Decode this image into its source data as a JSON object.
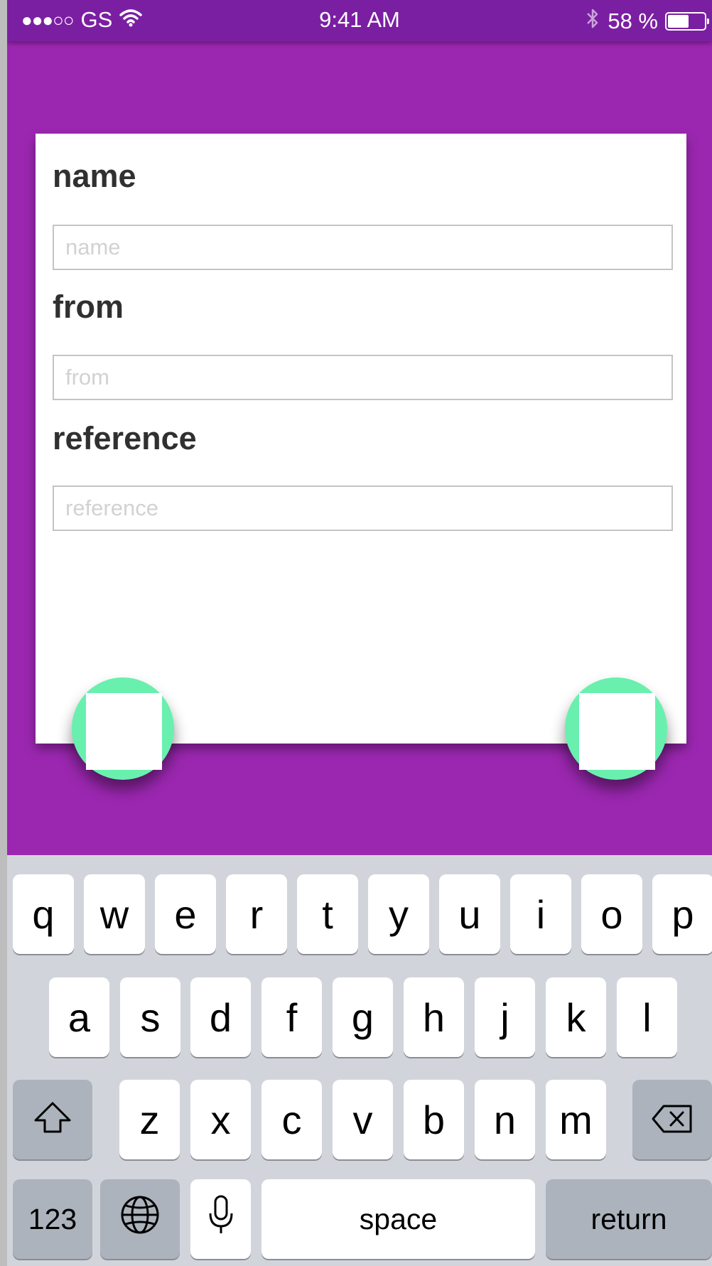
{
  "status_bar": {
    "signal": "●●●○○",
    "carrier": "GS",
    "time": "9:41 AM",
    "battery_percent": "58 %",
    "battery_level": 0.58
  },
  "form": {
    "fields": [
      {
        "label": "name",
        "placeholder": "name",
        "value": ""
      },
      {
        "label": "from",
        "placeholder": "from",
        "value": ""
      },
      {
        "label": "reference",
        "placeholder": "reference",
        "value": ""
      }
    ]
  },
  "fab_color": "#69f0ae",
  "background_color": "#9b27b0",
  "keyboard": {
    "row1": [
      "q",
      "w",
      "e",
      "r",
      "t",
      "y",
      "u",
      "i",
      "o",
      "p"
    ],
    "row2": [
      "a",
      "s",
      "d",
      "f",
      "g",
      "h",
      "j",
      "k",
      "l"
    ],
    "row3": [
      "z",
      "x",
      "c",
      "v",
      "b",
      "n",
      "m"
    ],
    "shift_icon": "shift-icon",
    "backspace_icon": "backspace-icon",
    "numbers_label": "123",
    "globe_icon": "globe-icon",
    "mic_icon": "microphone-icon",
    "space_label": "space",
    "return_label": "return"
  }
}
